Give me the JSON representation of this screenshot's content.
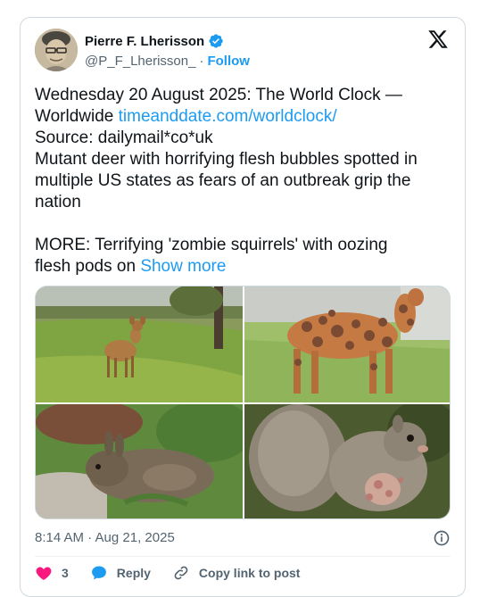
{
  "author": {
    "display_name": "Pierre F. Lherisson",
    "handle": "@P_F_Lherisson_",
    "separator": "·",
    "follow_label": "Follow"
  },
  "tweet": {
    "line1": "Wednesday 20 August 2025:  The World Clock —",
    "line2_text": "Worldwide ",
    "line2_link": "timeanddate.com/worldclock/",
    "line3": "Source: dailymail*co*uk",
    "line4": "Mutant deer with horrifying flesh bubbles spotted in",
    "line5": "multiple US states as fears of an outbreak grip the",
    "line6": "nation",
    "line7": "MORE:  Terrifying 'zombie squirrels' with oozing",
    "line8_text": "flesh pods on ",
    "show_more": "Show more"
  },
  "media": {
    "images": [
      "deer-on-lawn",
      "deer-with-flesh-bubbles",
      "rabbit-in-garden",
      "squirrel-with-growths"
    ]
  },
  "timestamp": "8:14 AM · Aug 21, 2025",
  "actions": {
    "like_count": "3",
    "reply_label": "Reply",
    "copy_link_label": "Copy link to post"
  },
  "colors": {
    "accent": "#1d9bf0",
    "like": "#f91880",
    "text": "#0f1419",
    "secondary": "#536471"
  }
}
